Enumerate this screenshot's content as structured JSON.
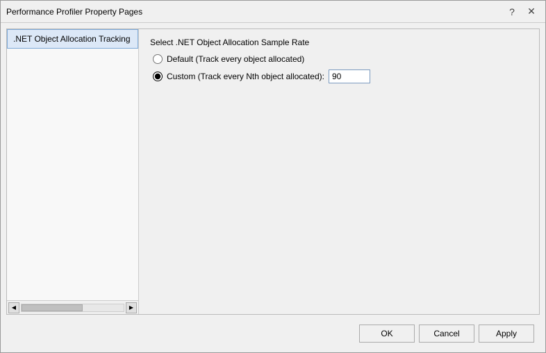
{
  "window": {
    "title": "Performance Profiler Property Pages",
    "help_btn": "?",
    "close_btn": "✕"
  },
  "sidebar": {
    "items": [
      {
        "label": ".NET Object Allocation Tracking"
      }
    ]
  },
  "content": {
    "section_title": "Select .NET Object Allocation Sample Rate",
    "radio_default_label": "Default (Track every object allocated)",
    "radio_custom_label": "Custom (Track every Nth object allocated):",
    "custom_value": "90"
  },
  "footer": {
    "ok_label": "OK",
    "cancel_label": "Cancel",
    "apply_label": "Apply"
  }
}
